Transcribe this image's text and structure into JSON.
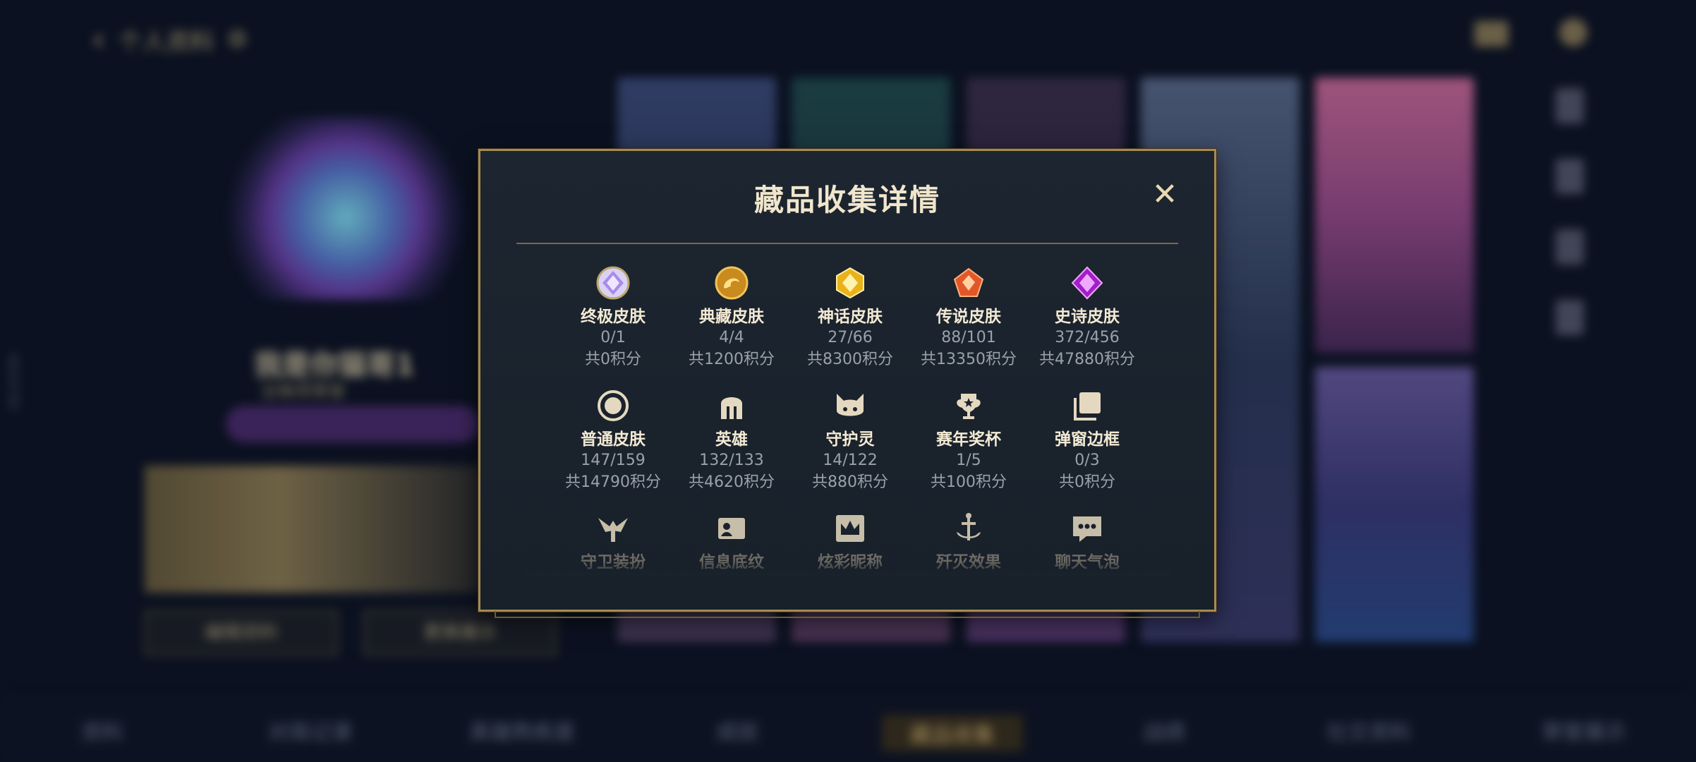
{
  "background": {
    "back_icon": "chevron-left-icon",
    "top_title": "个人资料",
    "player_name": "我是你猫哥1",
    "badge_text": "召唤师荣誉",
    "side_id": "4659708",
    "left_buttons": [
      "编辑资料",
      "更换展示"
    ],
    "nav_items": [
      "资料",
      "对局记录",
      "英雄熟练度",
      "成就",
      "藏品收集",
      "战绩",
      "社交资料",
      "荣誉展示"
    ],
    "nav_active_index": 4
  },
  "dialog": {
    "title": "藏品收集详情",
    "close_icon": "close-icon",
    "items": [
      {
        "icon": "ultimate-skin-icon",
        "name": "终极皮肤",
        "count": "0/1",
        "points": "共0积分"
      },
      {
        "icon": "treasure-skin-icon",
        "name": "典藏皮肤",
        "count": "4/4",
        "points": "共1200积分"
      },
      {
        "icon": "mythic-skin-icon",
        "name": "神话皮肤",
        "count": "27/66",
        "points": "共8300积分"
      },
      {
        "icon": "legendary-skin-icon",
        "name": "传说皮肤",
        "count": "88/101",
        "points": "共13350积分"
      },
      {
        "icon": "epic-skin-icon",
        "name": "史诗皮肤",
        "count": "372/456",
        "points": "共47880积分"
      },
      {
        "icon": "normal-skin-icon",
        "name": "普通皮肤",
        "count": "147/159",
        "points": "共14790积分"
      },
      {
        "icon": "champion-helmet-icon",
        "name": "英雄",
        "count": "132/133",
        "points": "共4620积分"
      },
      {
        "icon": "guardian-icon",
        "name": "守护灵",
        "count": "14/122",
        "points": "共880积分"
      },
      {
        "icon": "trophy-icon",
        "name": "赛年奖杯",
        "count": "1/5",
        "points": "共100积分"
      },
      {
        "icon": "frame-icon",
        "name": "弹窗边框",
        "count": "0/3",
        "points": "共0积分"
      },
      {
        "icon": "ward-skin-icon",
        "name": "守卫装扮",
        "count": "",
        "points": ""
      },
      {
        "icon": "banner-icon",
        "name": "信息底纹",
        "count": "",
        "points": ""
      },
      {
        "icon": "crown-nickname-icon",
        "name": "炫彩昵称",
        "count": "",
        "points": ""
      },
      {
        "icon": "finisher-icon",
        "name": "歼灭效果",
        "count": "",
        "points": ""
      },
      {
        "icon": "chat-bubble-icon",
        "name": "聊天气泡",
        "count": "",
        "points": ""
      }
    ]
  },
  "colors": {
    "accent_gold": "#a68a4e",
    "title_text": "#f0e6cc",
    "secondary_text": "#9aa1ab"
  }
}
